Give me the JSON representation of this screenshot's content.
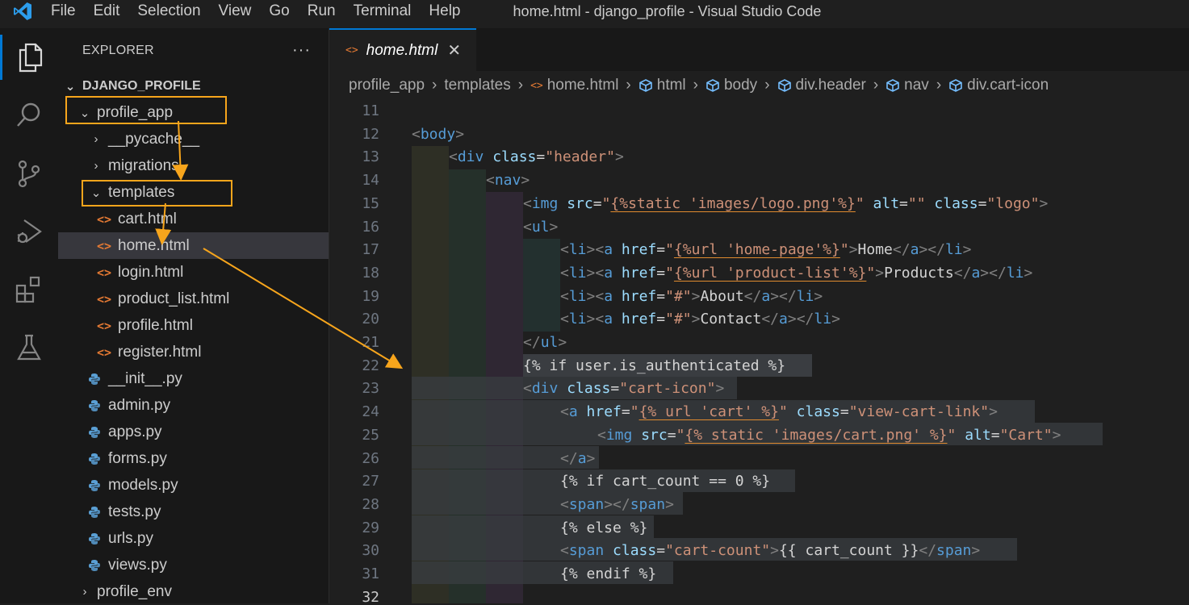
{
  "titlebar": {
    "menus": [
      "File",
      "Edit",
      "Selection",
      "View",
      "Go",
      "Run",
      "Terminal",
      "Help"
    ],
    "window_title": "home.html - django_profile - Visual Studio Code"
  },
  "activity_bar": {
    "items": [
      "explorer-icon",
      "search-icon",
      "source-control-icon",
      "run-debug-icon",
      "extensions-icon",
      "testing-icon"
    ],
    "accent": "#0078d4"
  },
  "explorer": {
    "title": "EXPLORER",
    "more": "···",
    "project": "DJANGO_PROFILE",
    "tree": [
      {
        "label": "profile_app",
        "type": "folder-open",
        "depth": 1
      },
      {
        "label": "__pycache__",
        "type": "folder",
        "depth": 2
      },
      {
        "label": "migrations",
        "type": "folder",
        "depth": 2
      },
      {
        "label": "templates",
        "type": "folder-open",
        "depth": 2
      },
      {
        "label": "cart.html",
        "type": "html",
        "depth": 3
      },
      {
        "label": "home.html",
        "type": "html",
        "depth": 3
      },
      {
        "label": "login.html",
        "type": "html",
        "depth": 3
      },
      {
        "label": "product_list.html",
        "type": "html",
        "depth": 3
      },
      {
        "label": "profile.html",
        "type": "html",
        "depth": 3
      },
      {
        "label": "register.html",
        "type": "html",
        "depth": 3
      },
      {
        "label": "__init__.py",
        "type": "py",
        "depth": 2
      },
      {
        "label": "admin.py",
        "type": "py",
        "depth": 2
      },
      {
        "label": "apps.py",
        "type": "py",
        "depth": 2
      },
      {
        "label": "forms.py",
        "type": "py",
        "depth": 2
      },
      {
        "label": "models.py",
        "type": "py",
        "depth": 2
      },
      {
        "label": "tests.py",
        "type": "py",
        "depth": 2
      },
      {
        "label": "urls.py",
        "type": "py",
        "depth": 2
      },
      {
        "label": "views.py",
        "type": "py",
        "depth": 2
      },
      {
        "label": "profile_env",
        "type": "folder",
        "depth": 1
      }
    ]
  },
  "editor": {
    "tab": {
      "label": "home.html",
      "close": "✕"
    },
    "breadcrumb": [
      "profile_app",
      "templates",
      "home.html",
      "html",
      "body",
      "div.header",
      "nav",
      "div.cart-icon"
    ],
    "line_numbers": [
      "11",
      "12",
      "13",
      "14",
      "15",
      "16",
      "17",
      "18",
      "19",
      "20",
      "21",
      "22",
      "23",
      "24",
      "25",
      "26",
      "27",
      "28",
      "29",
      "30",
      "31",
      "32"
    ],
    "current_line": "32"
  }
}
